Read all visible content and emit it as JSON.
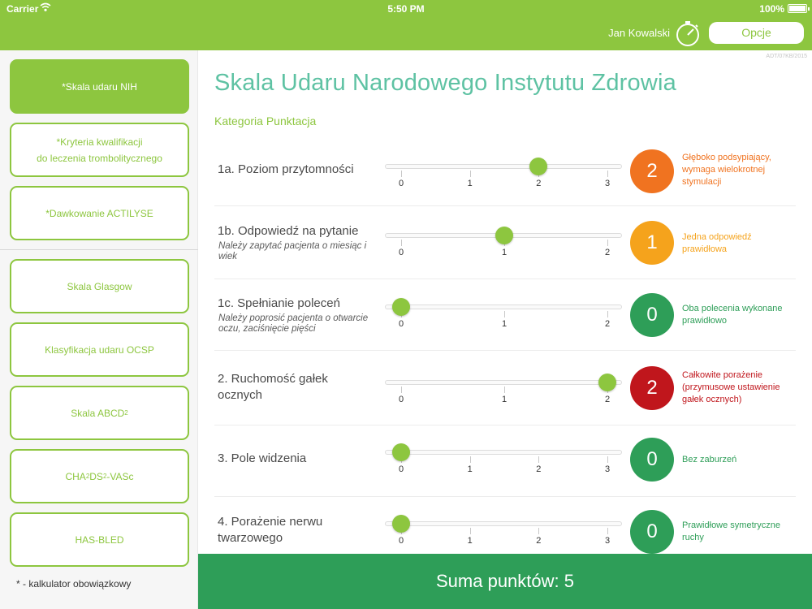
{
  "status_bar": {
    "carrier": "Carrier",
    "time": "5:50 PM",
    "battery": "100%"
  },
  "header": {
    "user_name": "Jan Kowalski",
    "options_label": "Opcje"
  },
  "sidebar": {
    "items": [
      {
        "label": "*Skala udaru NIH",
        "active": true
      },
      {
        "line1": "*Kryteria kwalifikacji",
        "line2": "do leczenia trombolitycznego"
      },
      {
        "label": "*Dawkowanie ACTILYSE"
      },
      {
        "label": "Skala Glasgow"
      },
      {
        "label": "Klasyfikacja udaru OCSP"
      },
      {
        "label": "Skala ABCD",
        "sub": "2"
      },
      {
        "p1": "CHA",
        "s1": "2",
        "p2": "DS",
        "s2": "2",
        "p3": "-VASc"
      },
      {
        "label": "HAS-BLED"
      }
    ],
    "note": "* - kalkulator obowiązkowy"
  },
  "main": {
    "doc_code": "ADT/07KB/2015",
    "title": "Skala Udaru Narodowego Instytutu Zdrowia",
    "category_header": "Kategoria Punktacja"
  },
  "colors": {
    "brand_green": "#8dc63f",
    "title_teal": "#5ec2a3",
    "footer_green": "#2e9e58",
    "score_orange_dark": "#f07320",
    "score_orange": "#f5a31c",
    "score_green": "#2e9e58",
    "score_red": "#c0161c"
  },
  "items": [
    {
      "title": "1a. Poziom przytomności",
      "subtitle": "",
      "ticks": [
        "0",
        "1",
        "2",
        "3"
      ],
      "value": 2,
      "score": "2",
      "score_color": "#f07320",
      "description": "Głęboko podsypiający, wymaga wielokrotnej stymulacji"
    },
    {
      "title": "1b. Odpowiedź na pytanie",
      "subtitle": "Należy zapytać pacjenta o miesiąc i wiek",
      "ticks": [
        "0",
        "1",
        "2"
      ],
      "value": 1,
      "score": "1",
      "score_color": "#f5a31c",
      "description": "Jedna odpowiedź prawidłowa"
    },
    {
      "title": "1c. Spełnianie poleceń",
      "subtitle": "Należy poprosić pacjenta o otwarcie oczu, zaciśnięcie pięści",
      "ticks": [
        "0",
        "1",
        "2"
      ],
      "value": 0,
      "score": "0",
      "score_color": "#2e9e58",
      "description": "Oba polecenia wykonane prawidłowo"
    },
    {
      "title": "2. Ruchomość gałek ocznych",
      "subtitle": "",
      "ticks": [
        "0",
        "1",
        "2"
      ],
      "value": 2,
      "score": "2",
      "score_color": "#c0161c",
      "description": "Całkowite porażenie (przymusowe ustawienie gałek ocznych)"
    },
    {
      "title": "3. Pole widzenia",
      "subtitle": "",
      "ticks": [
        "0",
        "1",
        "2",
        "3"
      ],
      "value": 0,
      "score": "0",
      "score_color": "#2e9e58",
      "description": "Bez zaburzeń"
    },
    {
      "title": "4. Porażenie nerwu twarzowego",
      "subtitle": "",
      "ticks": [
        "0",
        "1",
        "2",
        "3"
      ],
      "value": 0,
      "score": "0",
      "score_color": "#2e9e58",
      "description": "Prawidłowe symetryczne ruchy"
    }
  ],
  "footer": {
    "total_label": "Suma punktów: 5"
  }
}
